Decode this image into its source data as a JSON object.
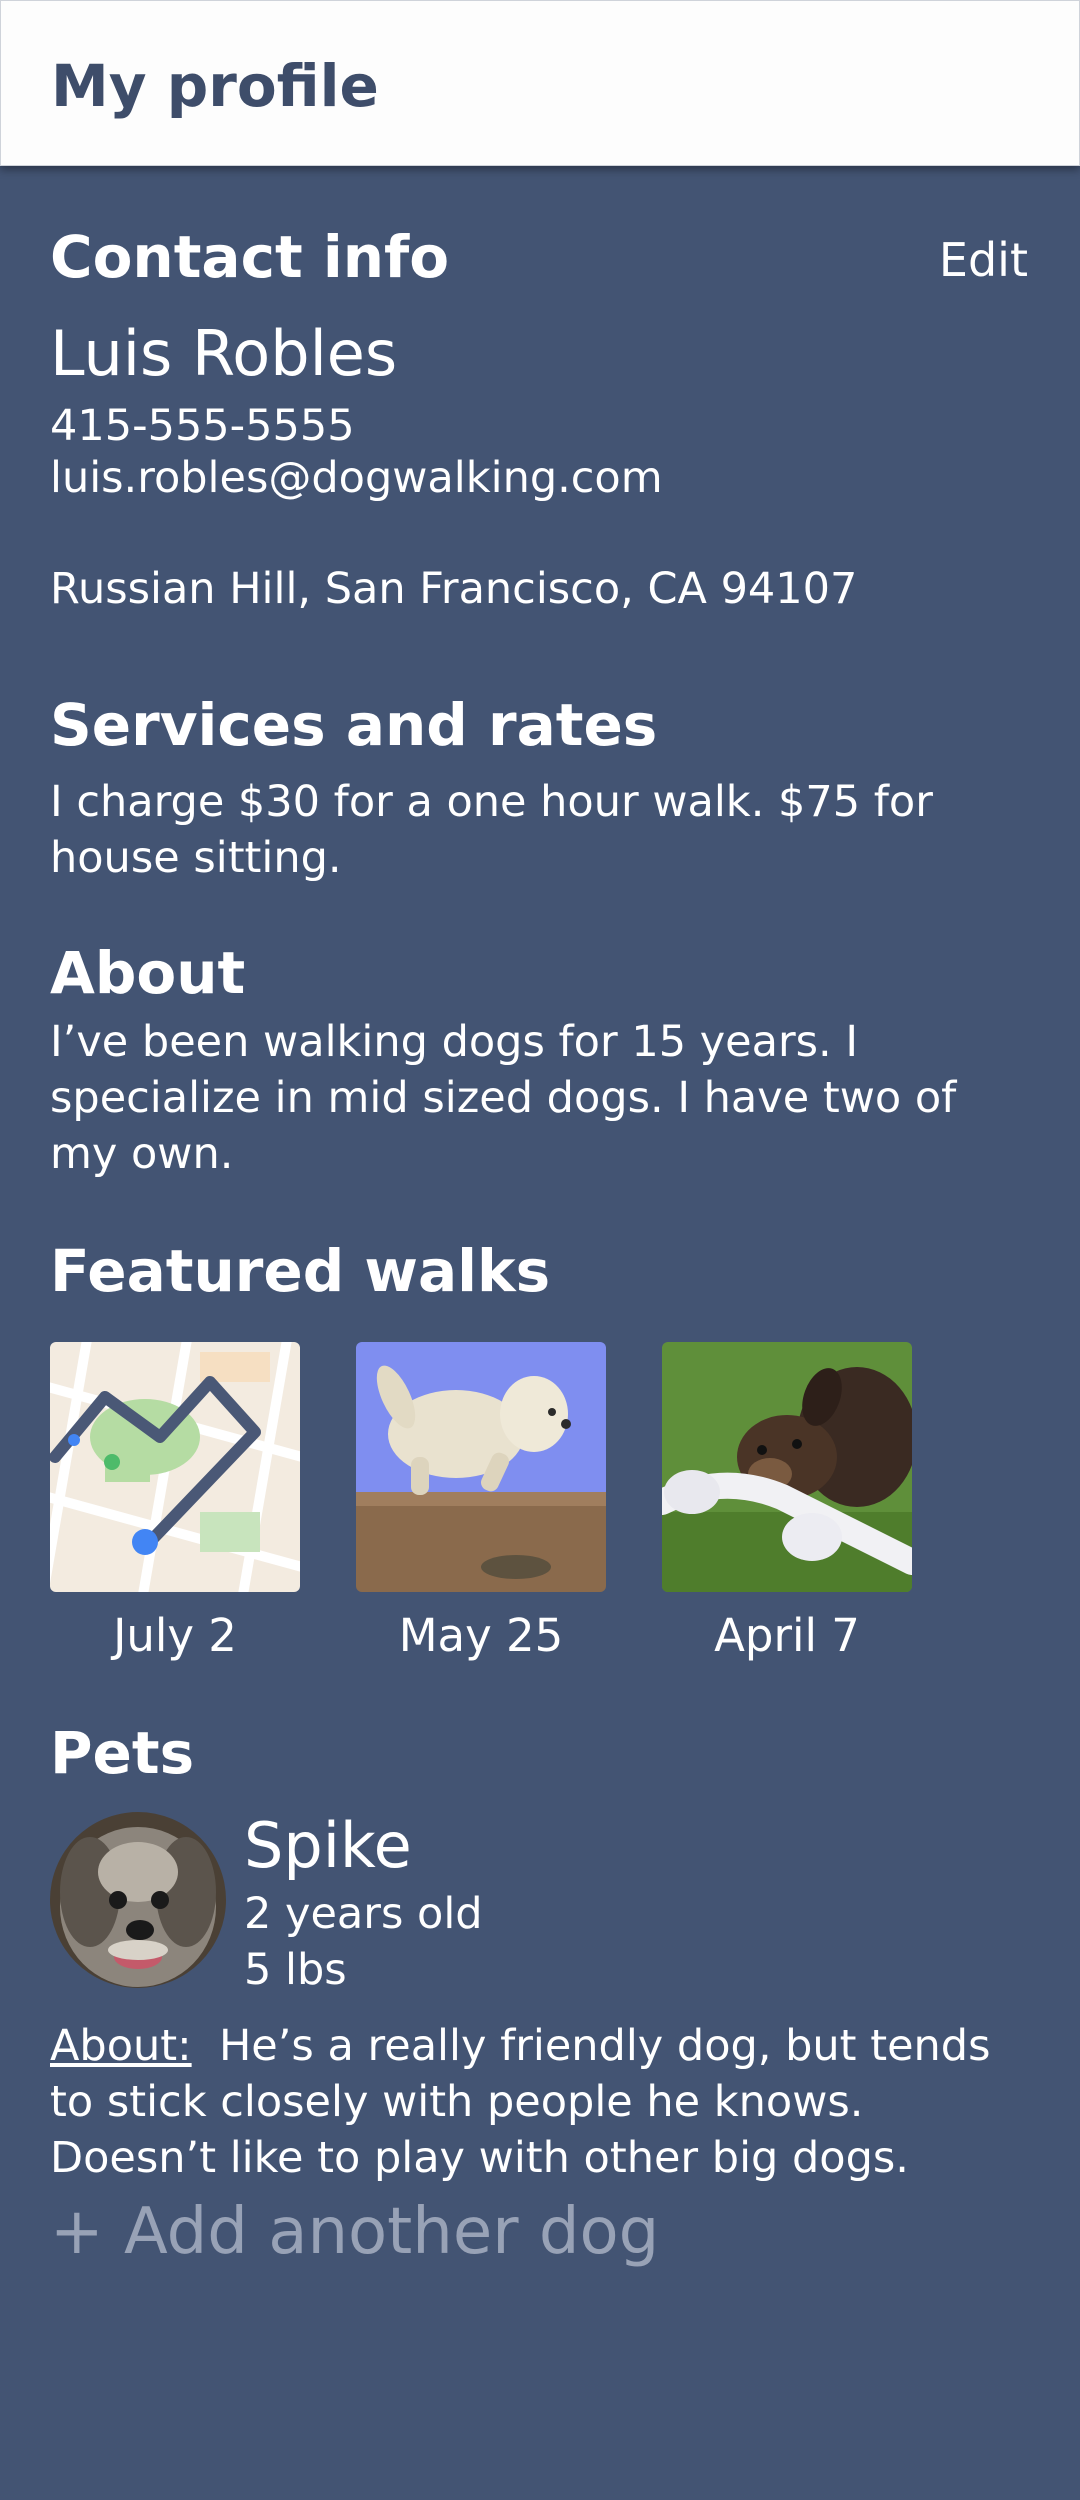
{
  "header": {
    "title": "My profile"
  },
  "contact": {
    "heading": "Contact info",
    "edit_label": "Edit",
    "name": "Luis Robles",
    "phone": "415-555-5555",
    "email": "luis.robles@dogwalking.com",
    "address": "Russian Hill, San Francisco, CA 94107"
  },
  "services": {
    "heading": "Services and rates",
    "text": "I charge $30 for a one hour walk. $75 for house sitting."
  },
  "about": {
    "heading": "About",
    "text": "I’ve been walking dogs for 15 years. I specialize in mid sized dogs. I have two of my own."
  },
  "featured_walks": {
    "heading": "Featured walks",
    "items": [
      {
        "caption": "July 2",
        "image": "map-route-thumbnail"
      },
      {
        "caption": "May 25",
        "image": "jumping-white-dog-photo"
      },
      {
        "caption": "April 7",
        "image": "puppy-with-rope-toy-photo"
      }
    ]
  },
  "pets": {
    "heading": "Pets",
    "items": [
      {
        "name": "Spike",
        "age": "2 years old",
        "weight": "5 lbs",
        "about_label": "About:",
        "about_text": "He’s a really friendly dog, but tends to stick closely with people he knows. Doesn’t like to play with other big dogs."
      }
    ],
    "add_label": "+ Add another dog"
  },
  "colors": {
    "background": "#435473",
    "header_background": "#fdfdfd",
    "header_text": "#3e4d6a",
    "text": "#ffffff",
    "muted_text": "#98a2b6"
  }
}
